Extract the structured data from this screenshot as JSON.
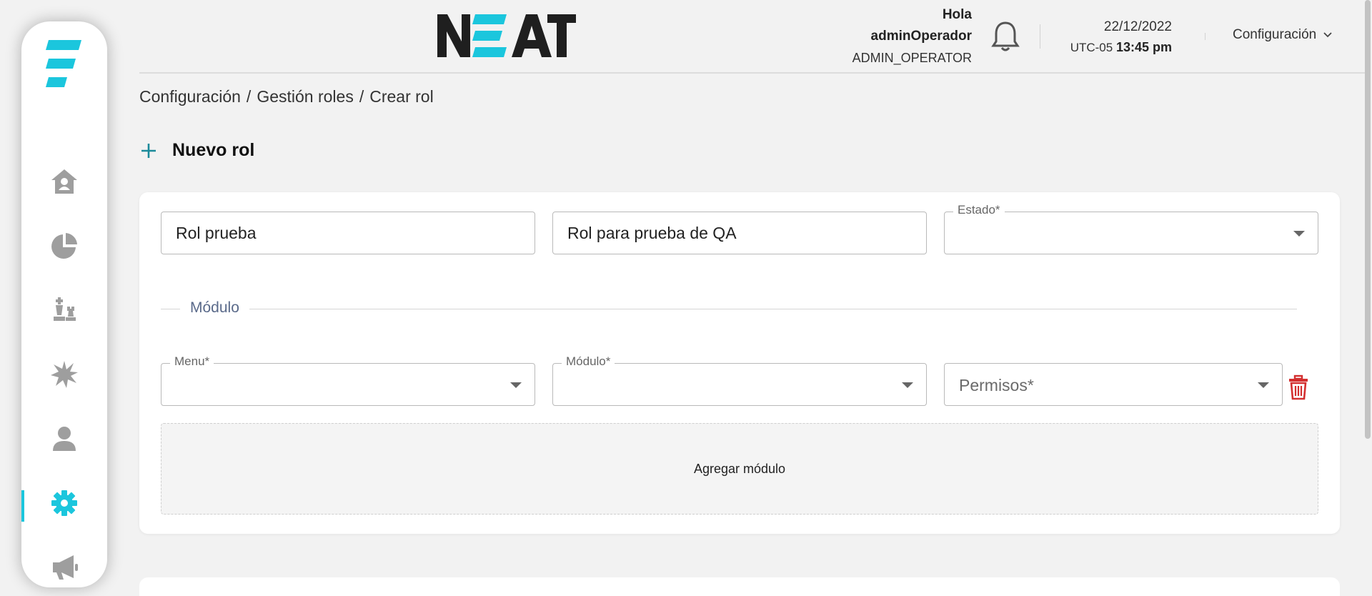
{
  "header": {
    "brand": "NEAT",
    "greeting": "Hola",
    "username": "adminOperador",
    "role": "ADMIN_OPERATOR",
    "date": "22/12/2022",
    "timezone": "UTC-05",
    "time": "13:45 pm",
    "config_menu": "Configuración"
  },
  "sidebar": {
    "items": [
      {
        "icon": "home-icon"
      },
      {
        "icon": "pie-chart-icon"
      },
      {
        "icon": "chess-icon"
      },
      {
        "icon": "starburst-icon"
      },
      {
        "icon": "user-icon"
      },
      {
        "icon": "gear-icon",
        "active": true
      },
      {
        "icon": "megaphone-icon"
      }
    ]
  },
  "breadcrumb": {
    "items": [
      "Configuración",
      "/",
      "Gestión roles",
      "/",
      "Crear rol"
    ]
  },
  "page": {
    "title": "Nuevo rol"
  },
  "form": {
    "role_name": "Rol prueba",
    "role_description": "Rol para prueba de QA",
    "estado_label": "Estado*",
    "section_label": "Módulo",
    "menu_label": "Menu*",
    "modulo_label": "Módulo*",
    "permisos_placeholder": "Permisos*",
    "add_module": "Agregar módulo"
  },
  "colors": {
    "accent": "#1bc6dd",
    "icon_gray": "#9e9e9e",
    "danger": "#d32f2f",
    "background": "#f2f2f2"
  }
}
